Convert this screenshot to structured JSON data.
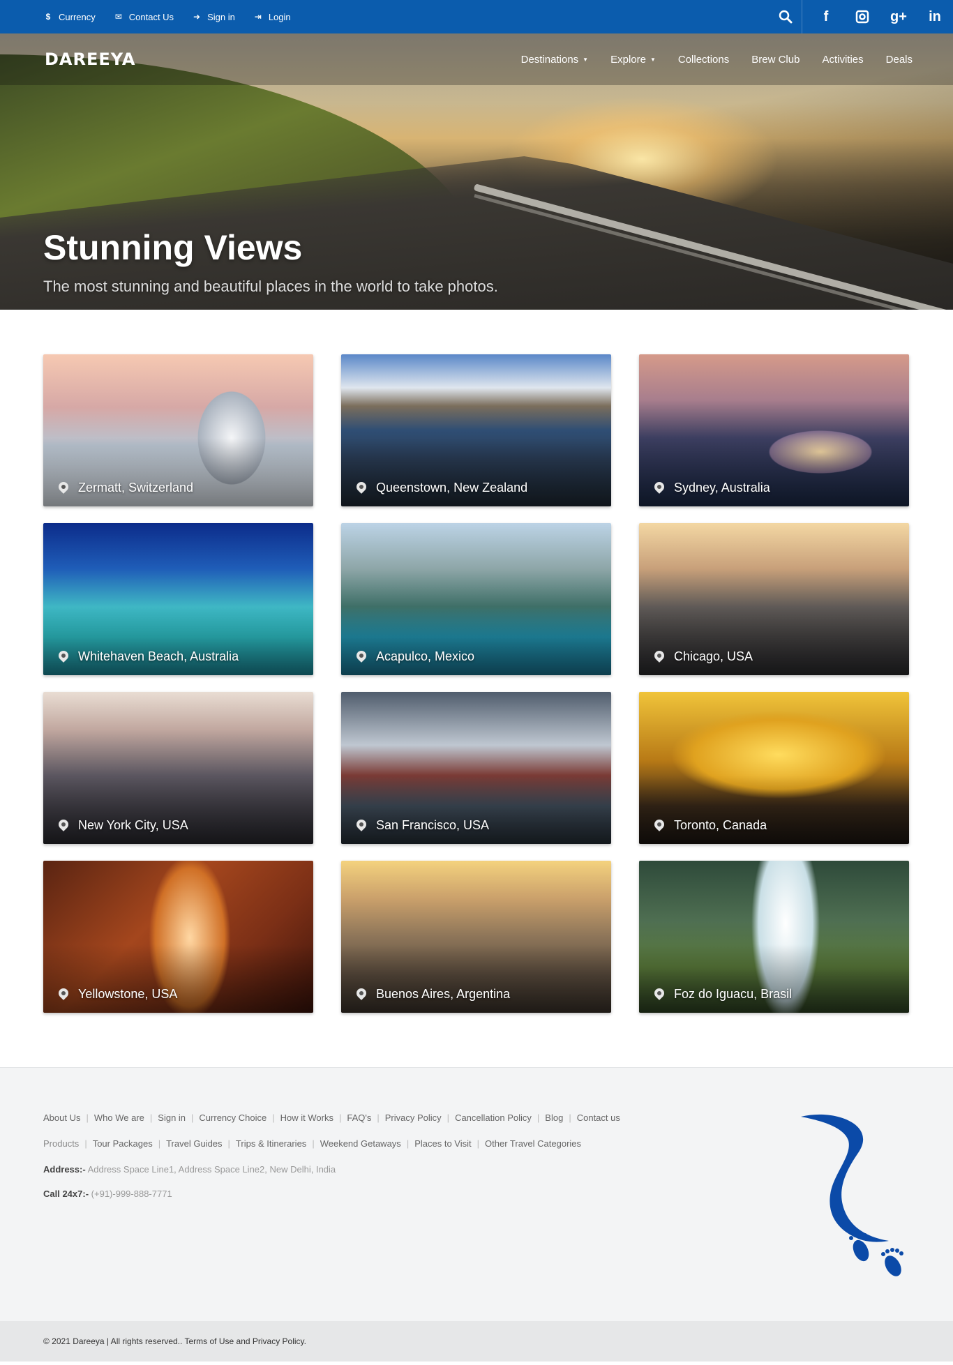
{
  "topbar": {
    "links": [
      {
        "icon": "dollar-icon",
        "glyph": "$",
        "label": "Currency"
      },
      {
        "icon": "envelope-icon",
        "glyph": "✉",
        "label": "Contact Us"
      },
      {
        "icon": "sign-in-icon",
        "glyph": "➜",
        "label": "Sign in"
      },
      {
        "icon": "login-icon",
        "glyph": "⇥",
        "label": "Login"
      }
    ],
    "social": [
      {
        "icon": "search-icon",
        "glyph": "⌕"
      },
      {
        "icon": "facebook-icon",
        "glyph": "f"
      },
      {
        "icon": "instagram-icon",
        "glyph": "◘"
      },
      {
        "icon": "google-plus-icon",
        "glyph": "g+"
      },
      {
        "icon": "linkedin-icon",
        "glyph": "in"
      }
    ],
    "color": "#0b5cad"
  },
  "nav": {
    "logo": "DAREEYA",
    "items": [
      "Destinations",
      "Explore",
      "Collections",
      "Brew Club",
      "Activities",
      "Deals"
    ]
  },
  "hero": {
    "title": "Stunning Views",
    "subtitle": "The most stunning and beautiful places in the world to take photos."
  },
  "places": [
    "Zermatt, Switzerland",
    "Queenstown, New Zealand",
    "Sydney, Australia",
    "Whitehaven Beach, Australia",
    "Acapulco, Mexico",
    "Chicago, USA",
    "New York City, USA",
    "San Francisco, USA",
    "Toronto, Canada",
    "Yellowstone, USA",
    "Buenos Aires, Argentina",
    "Foz do Iguacu, Brasil"
  ],
  "footer": {
    "links_row1": [
      "About Us",
      "Who We are",
      "Sign in",
      "Currency Choice",
      "How it Works",
      "FAQ's",
      "Privacy Policy",
      "Cancellation Policy",
      "Blog",
      "Contact us"
    ],
    "links_row2": [
      "Products",
      "Tour Packages",
      "Travel Guides",
      "Trips & Itineraries",
      "Weekend Getaways",
      "Places to Visit",
      "Other Travel Categories"
    ],
    "address_label": "Address:-",
    "address": "Address Space Line1, Address Space Line2, New Delhi, India",
    "call_label": "Call 24x7:-",
    "call": "(+91)-999-888-7771",
    "copyright": "© 2021 Dareeya | All rights reserved.. Terms of Use and Privacy Policy.",
    "logo_color": "#0b4aa8"
  }
}
